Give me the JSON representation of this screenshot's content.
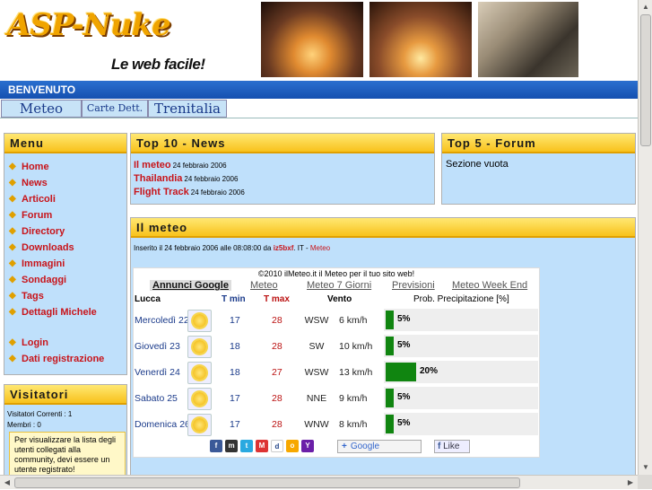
{
  "header": {
    "logo": "ASP-Nuke",
    "slogan": "Le web facile!",
    "welcome": "BENVENUTO"
  },
  "tabs": [
    "Meteo",
    "Carte Dett.",
    "Trenitalia"
  ],
  "menu": {
    "title": "Menu",
    "items": [
      "Home",
      "News",
      "Articoli",
      "Forum",
      "Directory",
      "Downloads",
      "Immagini",
      "Sondaggi",
      "Tags",
      "Dettagli Michele"
    ],
    "items2": [
      "Login",
      "Dati registrazione"
    ]
  },
  "visitors": {
    "title": "Visitatori",
    "current": "Visitatori Correnti : 1",
    "members": "Membri : 0",
    "notice": "Per visualizzare la lista degli utenti collegati alla community, devi essere un utente registrato!"
  },
  "top_news": {
    "title": "Top 10 - News",
    "items": [
      {
        "title": "Il meteo",
        "date": "24 febbraio 2006"
      },
      {
        "title": "Thailandia",
        "date": "24 febbraio 2006"
      },
      {
        "title": "Flight Track",
        "date": "24 febbraio 2006"
      }
    ]
  },
  "top_forum": {
    "title": "Top 5 - Forum",
    "empty": "Sezione vuota"
  },
  "article": {
    "title": "Il meteo",
    "meta_prefix": "Inserito il 24 febbraio 2006 alle 08:08:00 da",
    "author": "iz5bxf",
    "meta_mid": ". IT -",
    "category": "Meteo"
  },
  "meteo_widget": {
    "header": "©2010 ilMeteo.it il Meteo per il tuo sito web!",
    "tabs": [
      "Annunci Google",
      "Meteo",
      "Meteo 7 Giorni",
      "Previsioni",
      "Meteo Week End"
    ],
    "city": "Lucca",
    "col_tmin": "T min",
    "col_tmax": "T max",
    "col_wind": "Vento",
    "col_prec": "Prob. Precipitazione [%]",
    "rows": [
      {
        "day": "Mercoledì 22",
        "tmin": "17",
        "tmax": "28",
        "dir": "WSW",
        "speed": "6 km/h",
        "prec": "5%",
        "prec_val": 5
      },
      {
        "day": "Giovedì 23",
        "tmin": "18",
        "tmax": "28",
        "dir": "SW",
        "speed": "10 km/h",
        "prec": "5%",
        "prec_val": 5
      },
      {
        "day": "Venerdì 24",
        "tmin": "18",
        "tmax": "27",
        "dir": "WSW",
        "speed": "13 km/h",
        "prec": "20%",
        "prec_val": 20
      },
      {
        "day": "Sabato 25",
        "tmin": "17",
        "tmax": "28",
        "dir": "NNE",
        "speed": "9 km/h",
        "prec": "5%",
        "prec_val": 5
      },
      {
        "day": "Domenica 26",
        "tmin": "17",
        "tmax": "28",
        "dir": "WNW",
        "speed": "8 km/h",
        "prec": "5%",
        "prec_val": 5
      }
    ],
    "google_label": "Google",
    "like_label": "Like"
  },
  "colors": {
    "accent_blue": "#1550b0",
    "box_bg": "#bfe0fb",
    "title_yellow": "#f8c21c",
    "link_red": "#c8141a",
    "precip_green": "#108510"
  }
}
